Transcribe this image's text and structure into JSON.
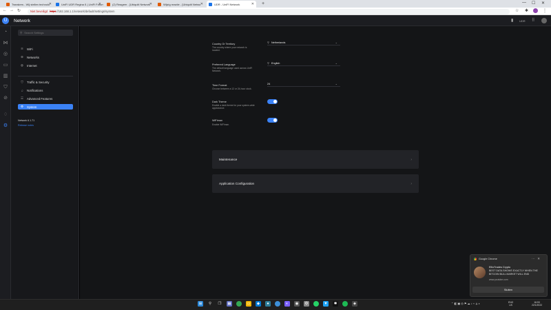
{
  "browser": {
    "tabs": [
      {
        "title": "Tweakers - Wij stellen technolo",
        "favicon_color": "#e05a00"
      },
      {
        "title": "UniFi UDR Regina ß | UniFi Forum",
        "favicon_color": "#1a73e8"
      },
      {
        "title": "(2) Reageer - [Ubiquiti Network",
        "favicon_color": "#e05a00"
      },
      {
        "title": "Wijzig reactie - [Ubiquiti Netwo",
        "favicon_color": "#e05a00"
      },
      {
        "title": "UDR - UniFi Network",
        "favicon_color": "#1a73e8"
      }
    ],
    "new_tab": "+",
    "address": {
      "warning": "Niet beveiligd",
      "scheme": "https",
      "rest": "://192.168.1.1/network/default/settings/system"
    }
  },
  "app": {
    "title": "Network",
    "logo_glyph": "U",
    "header_text": "UDR"
  },
  "sidebar": {
    "search_placeholder": "Search Settings",
    "groups": [
      [
        {
          "label": "WiFi",
          "icon": "wifi-icon",
          "glyph": "≋"
        },
        {
          "label": "Networks",
          "icon": "networks-icon",
          "glyph": "⊕"
        },
        {
          "label": "Internet",
          "icon": "globe-icon",
          "glyph": "◍"
        }
      ],
      [
        {
          "label": "Traffic & Security",
          "icon": "shield-icon",
          "glyph": "⛉"
        },
        {
          "label": "Notifications",
          "icon": "bell-icon",
          "glyph": "♫"
        },
        {
          "label": "Advanced Features",
          "icon": "sliders-icon",
          "glyph": "☰"
        },
        {
          "label": "System",
          "icon": "gear-icon",
          "glyph": "⚙",
          "active": true
        }
      ]
    ],
    "version": "Network 6.1.71",
    "release_notes": "Release notes"
  },
  "settings": {
    "country": {
      "label": "Country Or Territory",
      "desc": "The country where your network is located.",
      "value": "Netherlands"
    },
    "language": {
      "label": "Preferred Language",
      "desc": "The default language used across UniFi Network.",
      "value": "English"
    },
    "time_format": {
      "label": "Time Format",
      "desc": "Choose between a 12 or 24-hour clock.",
      "value": "24"
    },
    "dark_theme": {
      "label": "Dark Theme",
      "desc": "Enable a dark theme for your system-wide appearance.",
      "enabled": true
    },
    "wifiman": {
      "label": "WiFiman",
      "desc": "Enable WiFiman.",
      "enabled": true
    },
    "sections": [
      "Maintenance",
      "Application Configuration"
    ]
  },
  "notification": {
    "app": "Google Chrome",
    "title": "EllioTrades Crypto",
    "body": "BEST DATA SHOWS EXACTLY WHEN THE BITCOIN BULL MARKET WILL END",
    "source": "www.youtube.com",
    "button": "Sluiten"
  },
  "taskbar": {
    "lang_top": "ENG",
    "lang_bottom": "US",
    "time": "16:53",
    "date": "22/1/2022"
  }
}
